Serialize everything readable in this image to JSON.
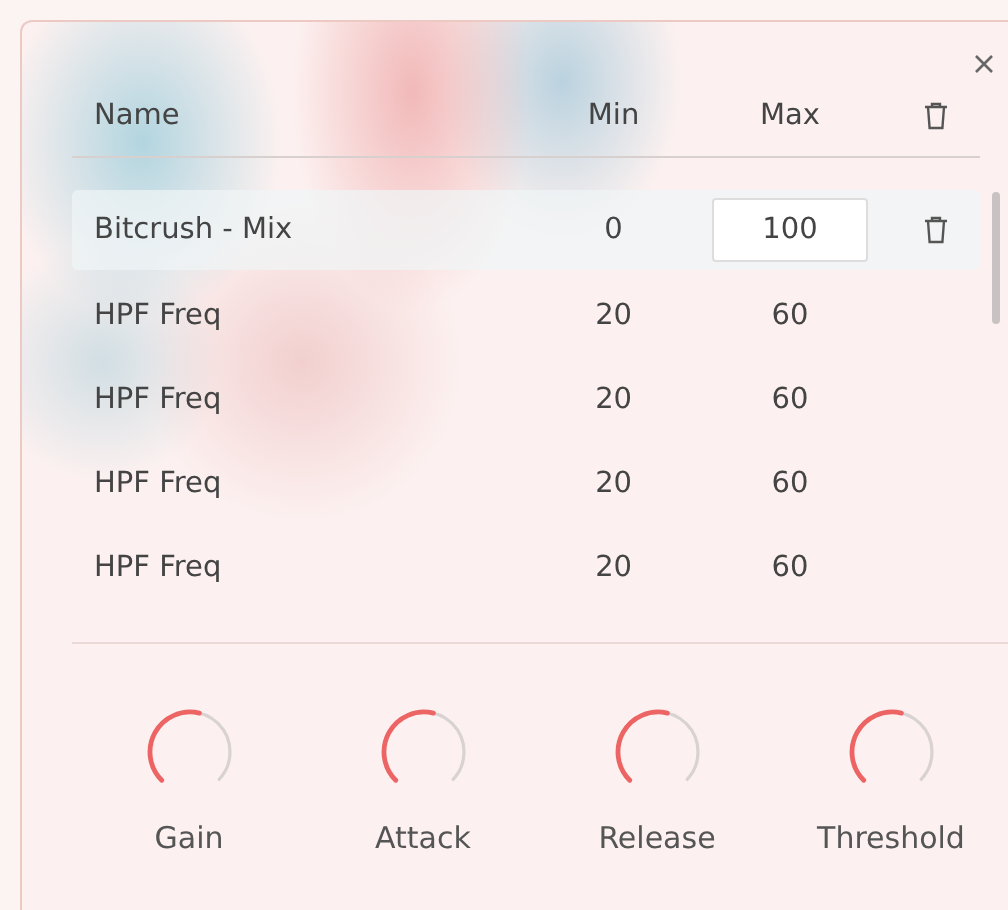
{
  "table": {
    "columns": [
      "Name",
      "Min",
      "Max"
    ],
    "rows": [
      {
        "name": "Bitcrush - Mix",
        "min": "0",
        "max": "100",
        "selected": true
      },
      {
        "name": "HPF Freq",
        "min": "20",
        "max": "60",
        "selected": false
      },
      {
        "name": "HPF Freq",
        "min": "20",
        "max": "60",
        "selected": false
      },
      {
        "name": "HPF Freq",
        "min": "20",
        "max": "60",
        "selected": false
      },
      {
        "name": "HPF Freq",
        "min": "20",
        "max": "60",
        "selected": false
      }
    ]
  },
  "knobs": [
    {
      "label": "Gain",
      "level": 0.55
    },
    {
      "label": "Attack",
      "level": 0.55
    },
    {
      "label": "Release",
      "level": 0.55
    },
    {
      "label": "Threshold",
      "level": 0.55
    }
  ]
}
